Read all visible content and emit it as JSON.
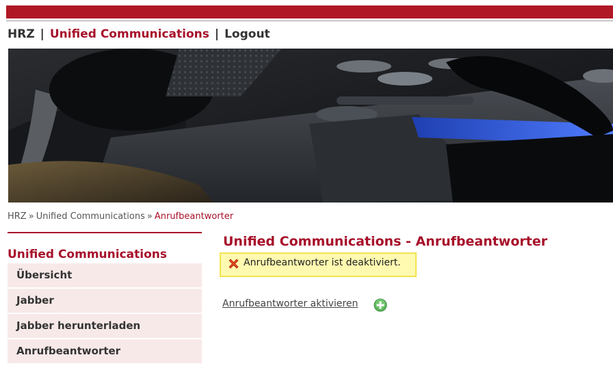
{
  "header": {
    "nav": [
      {
        "label": "HRZ"
      },
      {
        "label": "Unified Communications"
      },
      {
        "label": "Logout"
      }
    ],
    "separator": "|"
  },
  "banner": {
    "icon": "phone-photo-banner"
  },
  "breadcrumb": {
    "items": [
      "HRZ",
      "Unified Communications",
      "Anrufbeantworter"
    ],
    "separator": "»"
  },
  "sidebar": {
    "title": "Unified Communications",
    "items": [
      {
        "label": "Übersicht"
      },
      {
        "label": "Jabber"
      },
      {
        "label": "Jabber herunterladen"
      },
      {
        "label": "Anrufbeantworter"
      }
    ]
  },
  "main": {
    "title": "Unified Communications - Anrufbeantworter",
    "status_message": "Anrufbeantworter ist deaktiviert.",
    "status_icon": "error-x-icon",
    "action_link": "Anrufbeantworter aktivieren",
    "action_icon": "add-plus-icon"
  },
  "colors": {
    "brand_red": "#b01826",
    "accent_red": "#a7102a",
    "sidebar_bg": "#f8e9e9",
    "message_bg": "#fffab0",
    "message_border": "#f2e350",
    "success_green": "#4caf50"
  }
}
